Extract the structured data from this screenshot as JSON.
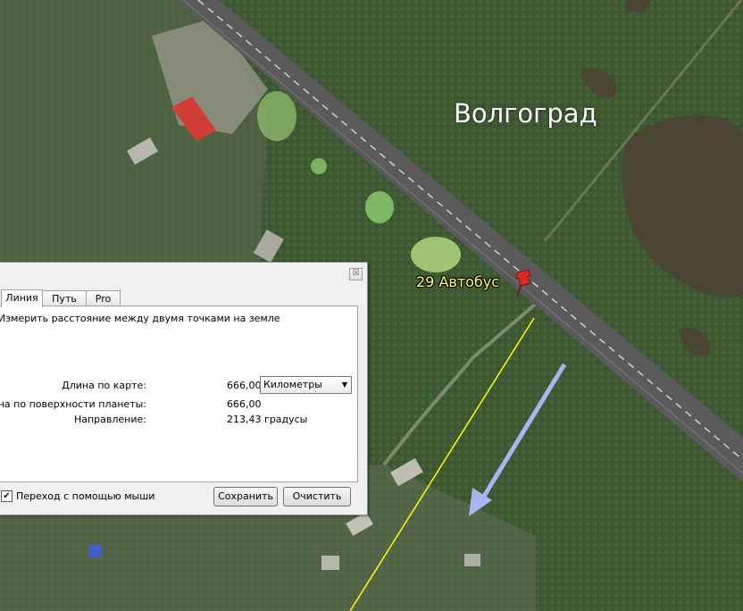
{
  "map": {
    "city_label": "Волгоград",
    "placemark_label": "29 Автобус",
    "colors": {
      "vegetation": "#3f5a33",
      "road": "#5b5b5b",
      "water": "#4a4633",
      "measure_line": "#ffff00",
      "arrow": "#a9b4f2",
      "roof_red": "#d23d36"
    },
    "icons": [
      "red-pushpin-icon",
      "direction-arrow-icon"
    ]
  },
  "dialog": {
    "close_glyph": "☒",
    "tabs": [
      {
        "label": "Линия",
        "selected": true
      },
      {
        "label": "Путь",
        "selected": false
      },
      {
        "label": "Pro",
        "selected": false
      }
    ],
    "description": "Измерить расстояние между двумя точками на земле",
    "map_length_label": "Длина по карте:",
    "map_length_value": "666,00",
    "units_selected": "Километры",
    "surface_length_label": "Длина по поверхности планеты:",
    "surface_length_value": "666,00",
    "heading_label": "Направление:",
    "heading_value": "213,43 градусы",
    "mouse_nav_label": "Переход с помощью мыши",
    "mouse_nav_checked": true,
    "save_label": "Сохранить",
    "clear_label": "Очистить"
  }
}
